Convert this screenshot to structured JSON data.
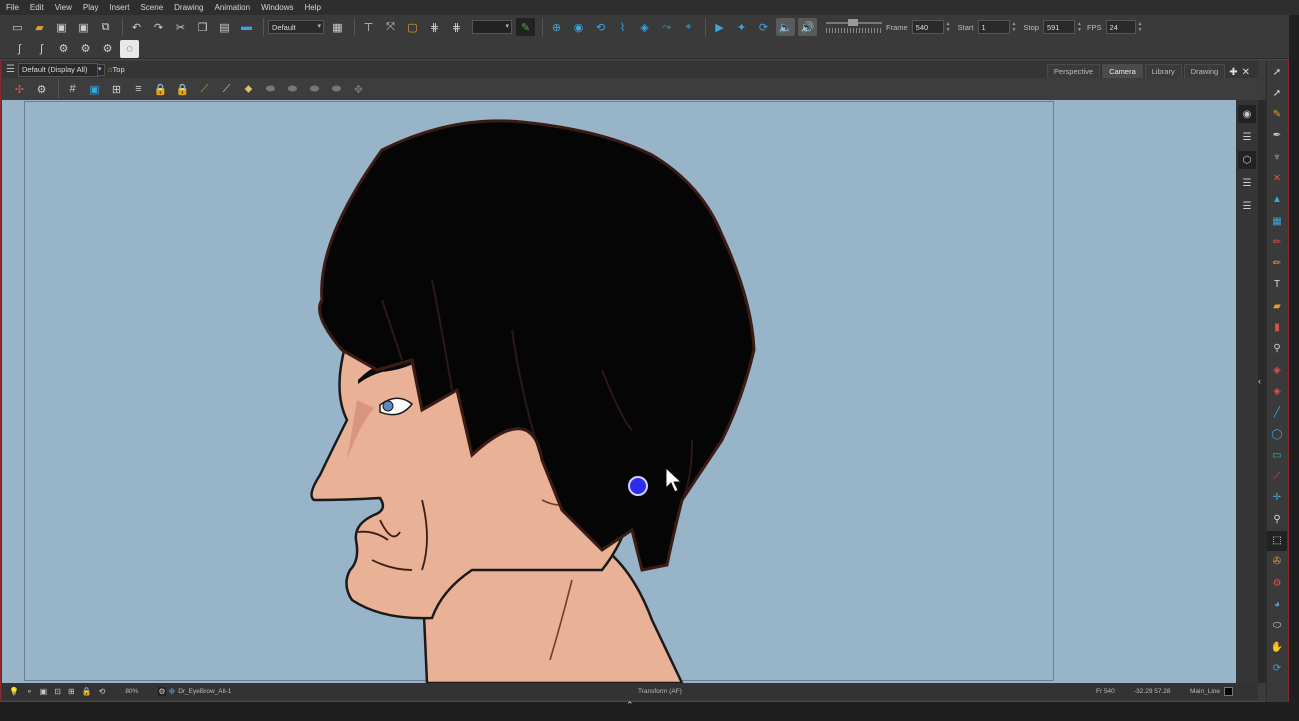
{
  "menu": [
    "File",
    "Edit",
    "View",
    "Play",
    "Insert",
    "Scene",
    "Drawing",
    "Animation",
    "Windows",
    "Help"
  ],
  "toolbar": {
    "workspace_value": "Default",
    "frame_label": "Frame",
    "frame_value": "540",
    "start_label": "Start",
    "start_value": "1",
    "stop_label": "Stop",
    "stop_value": "591",
    "fps_label": "FPS",
    "fps_value": "24"
  },
  "view": {
    "display_value": "Default (Display All)",
    "crumb": "Top",
    "tabs": [
      "Perspective",
      "Camera",
      "Library",
      "Drawing"
    ],
    "active_tab": "Camera"
  },
  "status": {
    "zoom": "80%",
    "layer": "Dr_EyeBrow_All-1",
    "tool": "Transform (AF)",
    "frame": "Fr 540",
    "coords": "-32.29 57.28",
    "line": "Main_Line"
  },
  "colors": {
    "background": "#98b4c9",
    "accent": "#3aa6e0",
    "border": "#8a2a2a",
    "skin": "#e9b196",
    "hair": "#050505",
    "cursor_dot": "#2d2df0"
  }
}
